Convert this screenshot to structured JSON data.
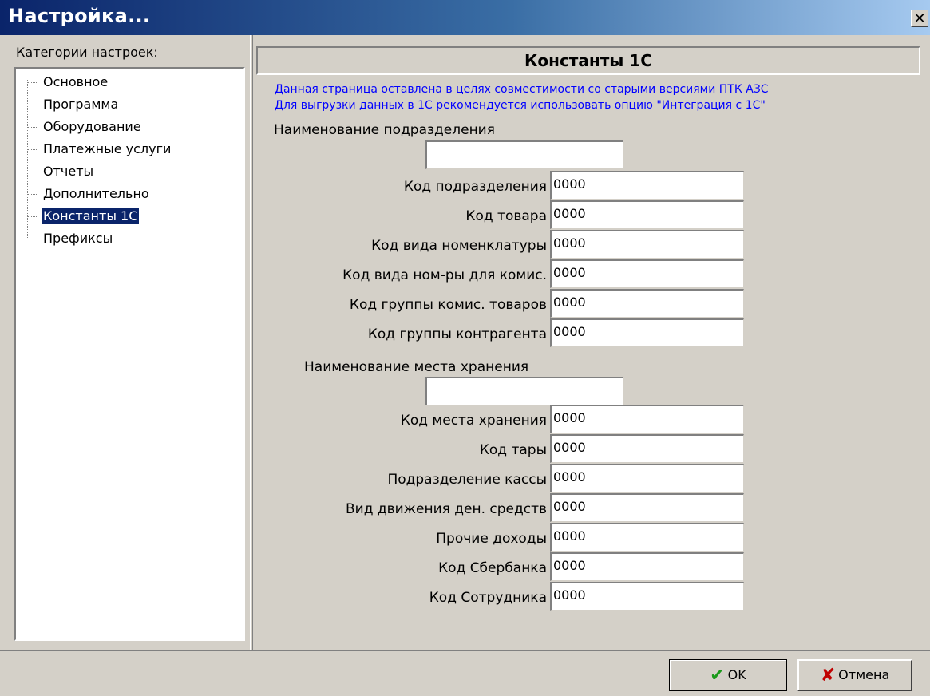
{
  "window": {
    "title": "Настройка...",
    "close_icon": "close-icon"
  },
  "categories": {
    "label": "Категории настроек:",
    "items": [
      {
        "label": "Основное"
      },
      {
        "label": "Программа"
      },
      {
        "label": "Оборудование"
      },
      {
        "label": "Платежные услуги"
      },
      {
        "label": "Отчеты"
      },
      {
        "label": "Дополнительно"
      },
      {
        "label": "Константы 1С",
        "selected": true
      },
      {
        "label": "Префиксы"
      }
    ]
  },
  "panel": {
    "title": "Константы 1С",
    "info_line1": "Данная страница оставлена в целях совместимости со старыми версиями ПТК АЗС",
    "info_line2": "Для выгрузки данных в 1С рекомендуется использовать опцию \"Интеграция с 1С\"",
    "division_name_label": "Наименование подразделения",
    "division_name_value": "",
    "group1": [
      {
        "label": "Код подразделения",
        "value": "0000"
      },
      {
        "label": "Код товара",
        "value": "0000"
      },
      {
        "label": "Код вида номенклатуры",
        "value": "0000"
      },
      {
        "label": "Код вида ном-ры для комис.",
        "value": "0000"
      },
      {
        "label": "Код группы комис. товаров",
        "value": "0000"
      },
      {
        "label": "Код группы контрагента",
        "value": "0000"
      }
    ],
    "storage_name_label": "Наименование места хранения",
    "storage_name_value": "",
    "group2": [
      {
        "label": "Код места хранения",
        "value": "0000"
      },
      {
        "label": "Код тары",
        "value": "0000"
      },
      {
        "label": "Подразделение кассы",
        "value": "0000"
      },
      {
        "label": "Вид движения ден. средств",
        "value": "0000"
      },
      {
        "label": "Прочие доходы",
        "value": "0000"
      },
      {
        "label": "Код Сбербанка",
        "value": "0000"
      },
      {
        "label": "Код Сотрудника",
        "value": "0000"
      }
    ]
  },
  "buttons": {
    "ok_label": "OK",
    "cancel_label": "Отмена"
  },
  "colors": {
    "info_text": "#0000ff",
    "selection": "#0a246a",
    "title_bar": "#0a246a"
  }
}
